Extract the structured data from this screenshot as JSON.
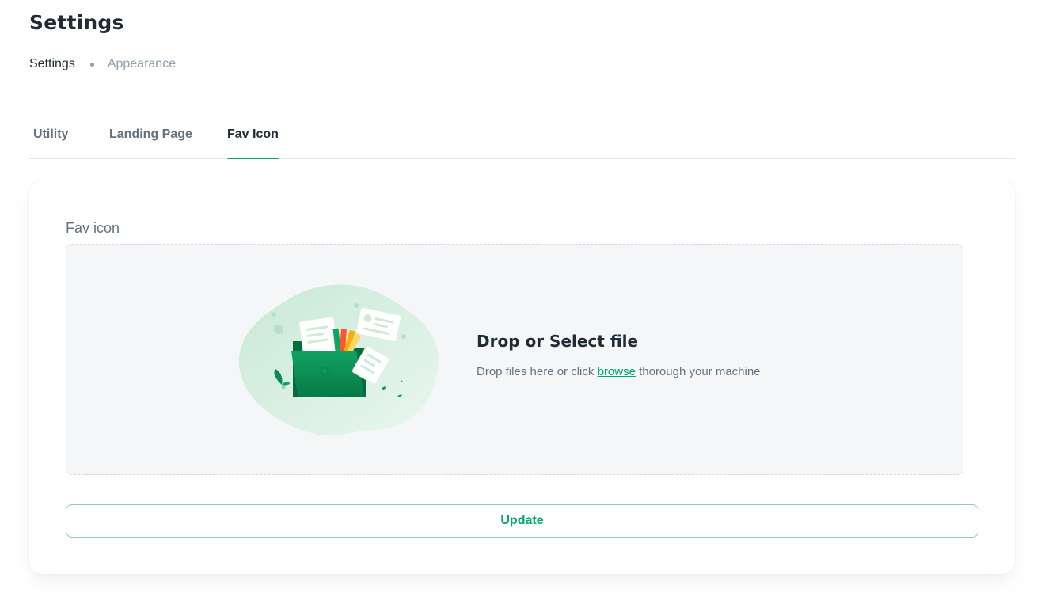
{
  "header": {
    "title": "Settings",
    "breadcrumb": [
      "Settings",
      "Appearance"
    ]
  },
  "tabs": [
    {
      "label": "Utility",
      "active": false
    },
    {
      "label": "Landing Page",
      "active": false
    },
    {
      "label": "Fav Icon",
      "active": true
    }
  ],
  "upload": {
    "label": "Fav icon",
    "title": "Drop or Select file",
    "subtitle_before": "Drop files here or click ",
    "link": "browse",
    "subtitle_after": " thorough your machine",
    "illustration_icon": "upload-folder-illustration"
  },
  "actions": {
    "update_label": "Update"
  },
  "colors": {
    "accent": "#00a76f",
    "text_primary": "#212b36",
    "text_secondary": "#637381",
    "muted": "#919eab"
  }
}
